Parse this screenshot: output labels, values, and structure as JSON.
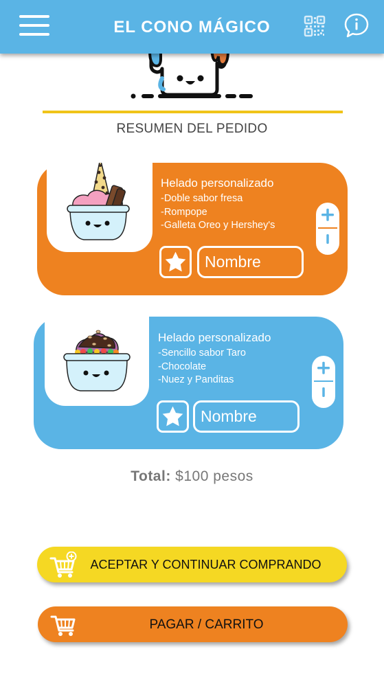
{
  "header": {
    "title": "EL CONO MÁGICO",
    "menu_icon": "hamburger-menu-icon",
    "qr_icon": "qr-code-icon",
    "info_icon": "info-bubble-icon",
    "background_color": "#5ab4e5"
  },
  "summary": {
    "title": "RESUMEN DEL PEDIDO",
    "divider_color": "#f0c419"
  },
  "orders": [
    {
      "name": "Helado personalizado",
      "details": [
        "-Doble sabor fresa",
        "-Rompope",
        "-Galleta Oreo y Hershey's"
      ],
      "name_placeholder": "Nombre",
      "plus_label": "+",
      "minus_label": "ı",
      "card_color": "#ee8220",
      "favorite_icon": "star-icon",
      "image_icon": "ice-cream-cup-icon"
    },
    {
      "name": "Helado personalizado",
      "details": [
        "-Sencillo sabor Taro",
        "-Chocolate",
        "-Nuez y Panditas"
      ],
      "name_placeholder": "Nombre",
      "plus_label": "+",
      "minus_label": "ı",
      "card_color": "#5ab4e5",
      "favorite_icon": "star-icon",
      "image_icon": "ice-cream-cup-icon"
    }
  ],
  "total": {
    "label": "Total:",
    "value": "$100 pesos"
  },
  "actions": {
    "continue_label": "ACEPTAR Y CONTINUAR COMPRANDO",
    "continue_icon": "cart-plus-icon",
    "continue_color": "#f5d823",
    "pay_label": "PAGAR / CARRITO",
    "pay_icon": "cart-icon",
    "pay_color": "#ee8220"
  }
}
